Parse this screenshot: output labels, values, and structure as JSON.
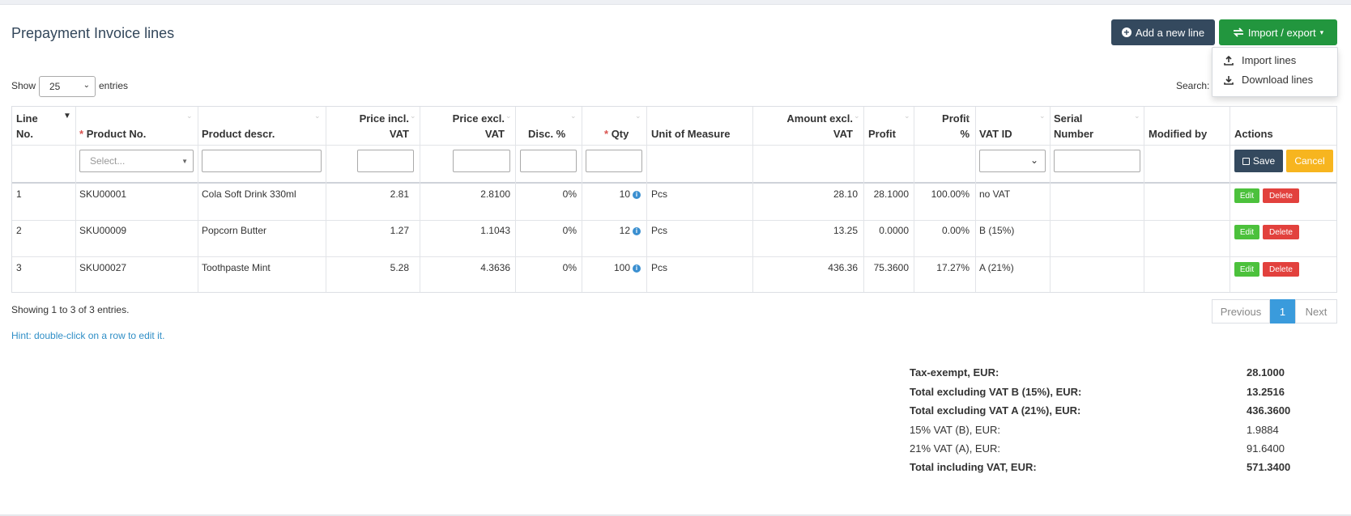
{
  "title": "Prepayment Invoice lines",
  "buttons": {
    "add_line": "Add a new line",
    "import_export": "Import / export"
  },
  "menu": {
    "import": "Import lines",
    "download": "Download lines"
  },
  "length": {
    "show": "Show",
    "value": "25",
    "entries": "entries"
  },
  "search_label": "Search:",
  "columns": {
    "line_no_1": "Line",
    "line_no_2": "No.",
    "product_no": "Product No.",
    "product_descr": "Product descr.",
    "price_incl_1": "Price incl.",
    "price_incl_2": "VAT",
    "price_excl_1": "Price excl.",
    "price_excl_2": "VAT",
    "disc": "Disc. %",
    "qty": "Qty",
    "uom": "Unit of Measure",
    "amount_1": "Amount excl.",
    "amount_2": "VAT",
    "profit": "Profit",
    "profit_pct_1": "Profit",
    "profit_pct_2": "%",
    "vat_id": "VAT ID",
    "serial_1": "Serial",
    "serial_2": "Number",
    "modified_by": "Modified by",
    "actions": "Actions"
  },
  "filter": {
    "product_placeholder": "Select...",
    "save": "Save",
    "cancel": "Cancel"
  },
  "rows": [
    {
      "line": "1",
      "product": "SKU00001",
      "descr": "Cola Soft Drink 330ml",
      "price_incl": "2.81",
      "price_excl": "2.8100",
      "disc": "0%",
      "qty": "10",
      "uom": "Pcs",
      "amount": "28.10",
      "profit": "28.1000",
      "profit_pct": "100.00%",
      "vat": "no VAT",
      "edit": "Edit",
      "delete": "Delete"
    },
    {
      "line": "2",
      "product": "SKU00009",
      "descr": "Popcorn Butter",
      "price_incl": "1.27",
      "price_excl": "1.1043",
      "disc": "0%",
      "qty": "12",
      "uom": "Pcs",
      "amount": "13.25",
      "profit": "0.0000",
      "profit_pct": "0.00%",
      "vat": "B (15%)",
      "edit": "Edit",
      "delete": "Delete"
    },
    {
      "line": "3",
      "product": "SKU00027",
      "descr": "Toothpaste Mint",
      "price_incl": "5.28",
      "price_excl": "4.3636",
      "disc": "0%",
      "qty": "100",
      "uom": "Pcs",
      "amount": "436.36",
      "profit": "75.3600",
      "profit_pct": "17.27%",
      "vat": "A (21%)",
      "edit": "Edit",
      "delete": "Delete"
    }
  ],
  "table_info": "Showing 1 to 3 of 3 entries.",
  "hint": "Hint: double-click on a row to edit it.",
  "pagination": {
    "previous": "Previous",
    "page": "1",
    "next": "Next"
  },
  "totals": [
    {
      "label": "Tax-exempt, EUR:",
      "value": "28.1000"
    },
    {
      "label": "Total excluding VAT B (15%), EUR:",
      "value": "13.2516"
    },
    {
      "label": "Total excluding VAT A (21%), EUR:",
      "value": "436.3600"
    },
    {
      "label": "15% VAT (B), EUR:",
      "value": "1.9884"
    },
    {
      "label": "21% VAT (A), EUR:",
      "value": "91.6400"
    },
    {
      "label": "Total including VAT, EUR:",
      "value": "571.3400"
    }
  ],
  "colors": {
    "dark_button": "#34495e",
    "green_button": "#22963e",
    "edit": "#4cc13c",
    "delete": "#e2413d",
    "cancel": "#f7b51f",
    "active_page": "#3a9bdc",
    "hint": "#2f8ec6"
  }
}
